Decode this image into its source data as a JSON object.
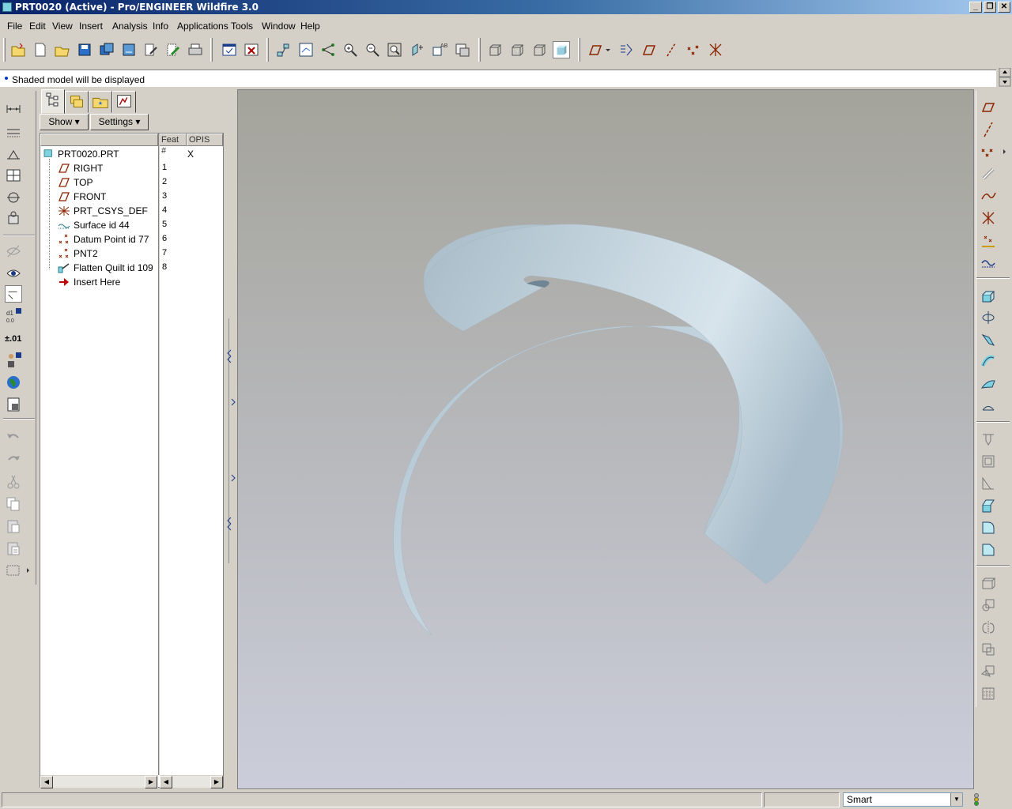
{
  "window": {
    "title": "PRT0020 (Active) - Pro/ENGINEER Wildfire 3.0",
    "buttons": [
      "_",
      "❐",
      "✕"
    ]
  },
  "menu": [
    "File",
    "Edit",
    "View",
    "Insert",
    "Analysis",
    "Info",
    "Applications",
    "Tools",
    "Window",
    "Help"
  ],
  "message": "Shaded model will be displayed",
  "panel": {
    "show_button": "Show ▾",
    "settings_button": "Settings ▾",
    "columns": {
      "feat": "Feat #",
      "opis": "OPIS"
    },
    "tree": [
      {
        "label": "PRT0020.PRT",
        "num": "",
        "opis": "X",
        "icon": "part-icon"
      },
      {
        "label": "RIGHT",
        "num": "1",
        "icon": "datum-plane-icon"
      },
      {
        "label": "TOP",
        "num": "2",
        "icon": "datum-plane-icon"
      },
      {
        "label": "FRONT",
        "num": "3",
        "icon": "datum-plane-icon"
      },
      {
        "label": "PRT_CSYS_DEF",
        "num": "4",
        "icon": "csys-icon"
      },
      {
        "label": "Surface id 44",
        "num": "5",
        "icon": "surface-icon"
      },
      {
        "label": "Datum Point id 77",
        "num": "6",
        "icon": "datum-point-icon"
      },
      {
        "label": "PNT2",
        "num": "7",
        "icon": "datum-point-icon"
      },
      {
        "label": "Flatten Quilt id 109",
        "num": "8",
        "icon": "flatten-quilt-icon"
      },
      {
        "label": "Insert Here",
        "num": "",
        "icon": "insert-arrow-icon"
      }
    ]
  },
  "status": {
    "filter": "Smart"
  },
  "colors": {
    "accent": "#0a246a",
    "surface": "#b4c6d0",
    "datum": "#8b2500"
  }
}
